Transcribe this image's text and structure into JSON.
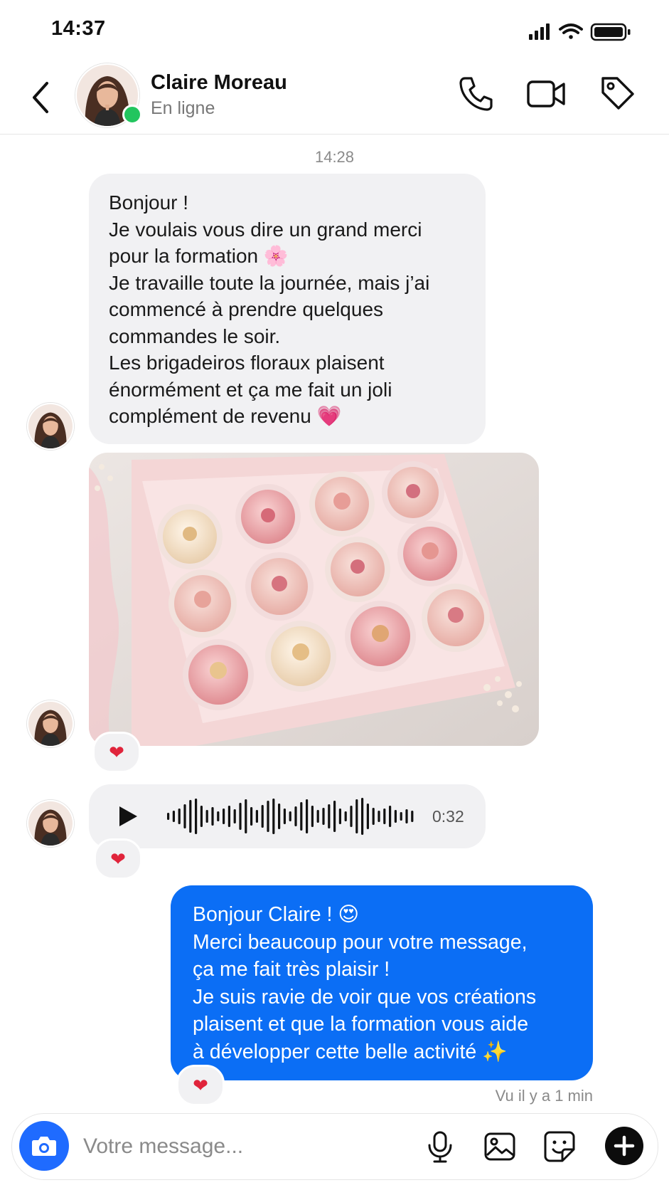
{
  "status_bar": {
    "time": "14:37"
  },
  "header": {
    "contact_name": "Claire Moreau",
    "contact_status": "En ligne",
    "online_color": "#22c55e",
    "icons": [
      "back-arrow-icon",
      "phone-icon",
      "video-camera-icon",
      "tag-icon"
    ]
  },
  "thread": {
    "timestamp": "14:28",
    "incoming_message": {
      "lines": [
        "Bonjour !",
        "Je voulais vous dire un grand merci",
        "pour la formation 🌸",
        "Je travaille toute la journée, mais j’ai",
        "commencé à prendre quelques",
        "commandes le soir.",
        "Les brigadeiros floraux plaisent",
        "énormément et ça me fait un joli",
        "complément de revenu 💗"
      ]
    },
    "photo": {
      "subject": "box of flower-decorated brigadeiros",
      "reaction": "❤"
    },
    "voice_message": {
      "duration": "0:32",
      "reaction": "❤"
    },
    "outgoing_message": {
      "lines": [
        "Bonjour Claire !  😍",
        "Merci beaucoup pour votre message,",
        "ça me fait très plaisir !",
        "Je suis ravie de voir que vos créations",
        "plaisent et que la formation vous aide",
        "à développer cette belle activité ✨"
      ],
      "reaction": "❤",
      "bubble_color": "#0b6ef5"
    },
    "seen_status": "Vu il y a 1 min"
  },
  "composer": {
    "placeholder": "Votre message...",
    "icons": [
      "camera-icon",
      "microphone-icon",
      "gallery-icon",
      "sticker-icon",
      "plus-icon"
    ],
    "camera_color": "#1f6bff"
  }
}
